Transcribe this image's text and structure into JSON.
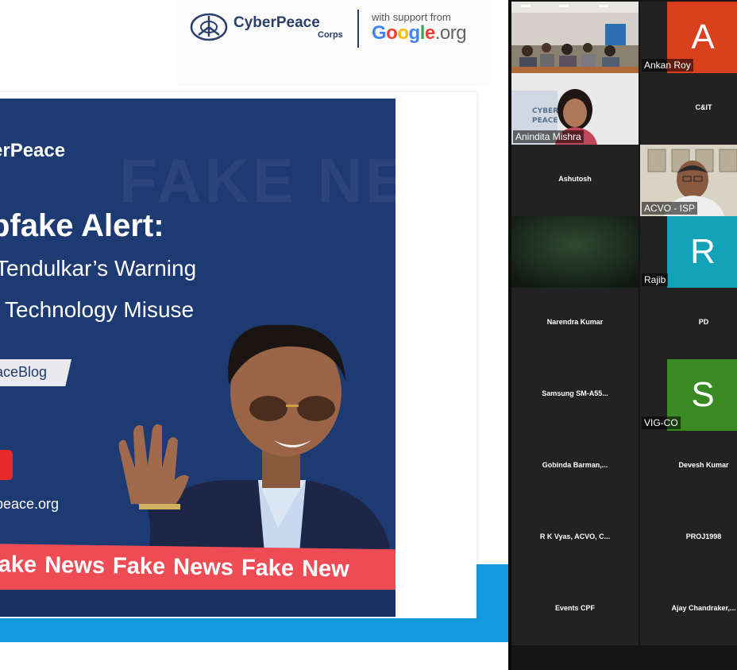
{
  "header": {
    "brand_name": "CyberPeace",
    "brand_sub": "Corps",
    "support_text": "with support from",
    "google": [
      "G",
      "o",
      "o",
      "g",
      "l",
      "e"
    ],
    "google_suffix": ".org"
  },
  "poster": {
    "bg_text": "FAKE NEWS",
    "brand": "erPeace",
    "title": "pfake Alert:",
    "subtitle_line1": "Tendulkar’s Warning",
    "subtitle_line2": "Technology Misuse",
    "tag": "aceBlog",
    "url": "peace.org",
    "band_text": "Fake News   Fake News   Fake New"
  },
  "participants": [
    {
      "name": "",
      "label": "",
      "type": "video-room"
    },
    {
      "name": "",
      "label": "Ankan Roy",
      "type": "avatar",
      "initial": "A",
      "color": "#d8401e"
    },
    {
      "name": "",
      "label": "Anindita Mishra",
      "type": "video-person"
    },
    {
      "name": "C&IT",
      "label": "",
      "type": "name"
    },
    {
      "name": "Ashutosh",
      "label": "",
      "type": "name"
    },
    {
      "name": "",
      "label": "ACVO - ISP",
      "type": "video-man"
    },
    {
      "name": "",
      "label": "",
      "type": "video-dark"
    },
    {
      "name": "",
      "label": "Rajib",
      "type": "avatar",
      "initial": "R",
      "color": "#12a3b8"
    },
    {
      "name": "Narendra Kumar",
      "label": "",
      "type": "name"
    },
    {
      "name": "PD",
      "label": "",
      "type": "name"
    },
    {
      "name": "Samsung  SM-A55...",
      "label": "",
      "type": "name"
    },
    {
      "name": "",
      "label": "VIG-CO",
      "type": "avatar",
      "initial": "S",
      "color": "#3a8a23"
    },
    {
      "name": "Gobinda  Barman,...",
      "label": "",
      "type": "name"
    },
    {
      "name": "Devesh Kumar",
      "label": "",
      "type": "name"
    },
    {
      "name": "R K Vyas, ACVO, C...",
      "label": "",
      "type": "name"
    },
    {
      "name": "PROJ1998",
      "label": "",
      "type": "name"
    },
    {
      "name": "Events CPF",
      "label": "",
      "type": "name"
    },
    {
      "name": "Ajay  Chandraker,...",
      "label": "",
      "type": "name"
    }
  ],
  "colors": {
    "poster_bg": "#1e3a73",
    "band": "#ee4c55",
    "strip": "#139ae0",
    "gallery_bg": "#151515",
    "tile_bg": "#232222"
  }
}
